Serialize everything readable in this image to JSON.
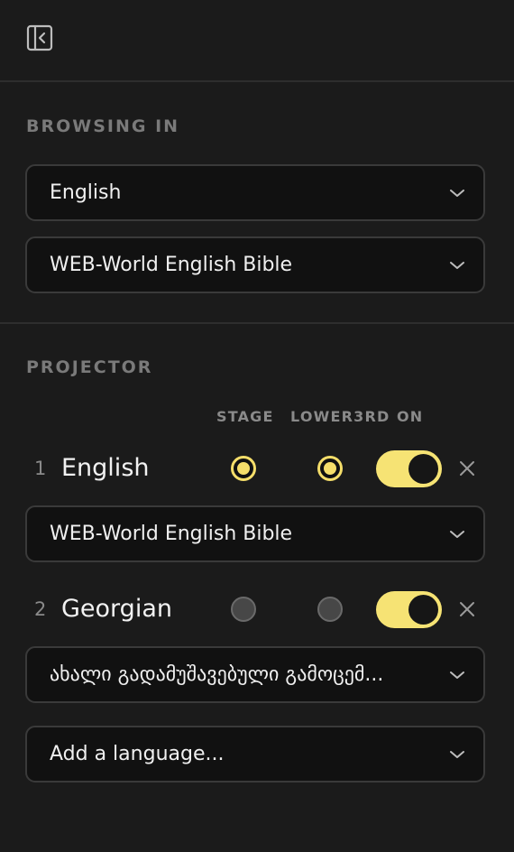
{
  "browsing": {
    "section_label": "BROWSING IN",
    "language": "English",
    "bible": "WEB-World English Bible"
  },
  "projector": {
    "section_label": "PROJECTOR",
    "columns": {
      "stage": "STAGE",
      "lower3rd": "LOWER3RD",
      "on": "ON"
    },
    "rows": [
      {
        "number": "1",
        "language": "English",
        "stage": true,
        "lower3rd": true,
        "on": true,
        "bible": "WEB-World English Bible"
      },
      {
        "number": "2",
        "language": "Georgian",
        "stage": false,
        "lower3rd": false,
        "on": true,
        "bible": "ახალი გადამუშავებული გამოცემ..."
      }
    ],
    "add_language_placeholder": "Add a language..."
  },
  "colors": {
    "accent": "#f5de6a",
    "background": "#1b1b1b",
    "field": "#111111"
  }
}
